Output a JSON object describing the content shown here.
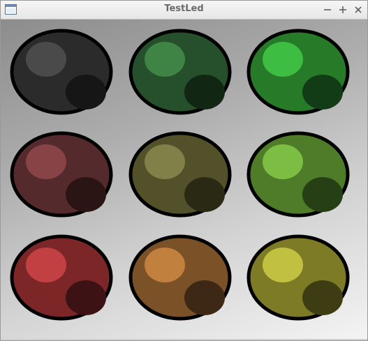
{
  "window": {
    "title": "TestLed"
  },
  "title_icons": {
    "app": "window-icon",
    "minimize": "minimize-icon",
    "maximize": "maximize-icon",
    "close": "close-icon"
  },
  "leds": [
    {
      "name": "led-off-gray",
      "body": "#2b2b2b",
      "highlight": "#4a4a4a",
      "shade": "#161616"
    },
    {
      "name": "led-dim-green",
      "body": "#26502b",
      "highlight": "#3f8444",
      "shade": "#112713"
    },
    {
      "name": "led-on-green",
      "body": "#267a28",
      "highlight": "#3dbd42",
      "shade": "#123c15"
    },
    {
      "name": "led-dim-red",
      "body": "#542a2c",
      "highlight": "#874345",
      "shade": "#2b1414"
    },
    {
      "name": "led-dim-olive",
      "body": "#535129",
      "highlight": "#818049",
      "shade": "#2a2a14"
    },
    {
      "name": "led-lime",
      "body": "#4e7c28",
      "highlight": "#7cbd44",
      "shade": "#263f14"
    },
    {
      "name": "led-red",
      "body": "#7c2628",
      "highlight": "#c24042",
      "shade": "#3d1214"
    },
    {
      "name": "led-orange",
      "body": "#7b5128",
      "highlight": "#c2803f",
      "shade": "#3c2815"
    },
    {
      "name": "led-yellow",
      "body": "#7d7b26",
      "highlight": "#c2c040",
      "shade": "#3d3c13"
    }
  ]
}
